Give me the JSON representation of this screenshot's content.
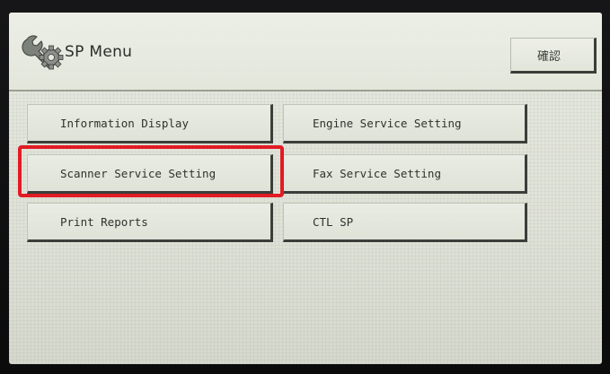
{
  "header": {
    "title": "SP Menu",
    "confirm_label": "確認"
  },
  "menu": {
    "items": [
      {
        "label": "Information Display"
      },
      {
        "label": "Engine Service Setting"
      },
      {
        "label": "Scanner Service Setting"
      },
      {
        "label": "Fax Service Setting"
      },
      {
        "label": "Print Reports"
      },
      {
        "label": "CTL SP"
      }
    ]
  },
  "icons": {
    "app": "wrench-gear-icon"
  },
  "colors": {
    "highlight": "#e21b24",
    "screen_bg": "#e3e6db",
    "button_shadow": "#3b3e39"
  }
}
